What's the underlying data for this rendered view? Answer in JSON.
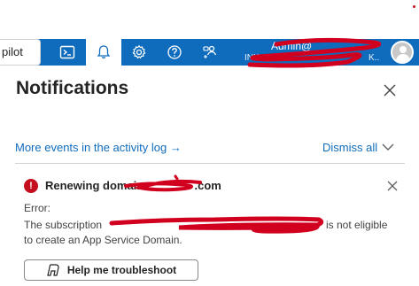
{
  "topbar": {
    "copilot_label": "pilot",
    "account_name": "Admin@",
    "account_directory": "INK",
    "account_directory_tail": "K.."
  },
  "panel": {
    "title": "Notifications",
    "more_events_link": "More events in the activity log →",
    "dismiss_all": "Dismiss all"
  },
  "notification": {
    "title_start": "Renewing domain",
    "title_end": ".com",
    "error_label": "Error:",
    "message_start": "The subscription ",
    "message_end": "is not eligible",
    "message_line2": "to create an App Service Domain.",
    "troubleshoot_label": "Help me troubleshoot"
  },
  "colors": {
    "accent": "#0f6cbd",
    "error": "#c50f1f",
    "redaction": "#d1001f"
  }
}
